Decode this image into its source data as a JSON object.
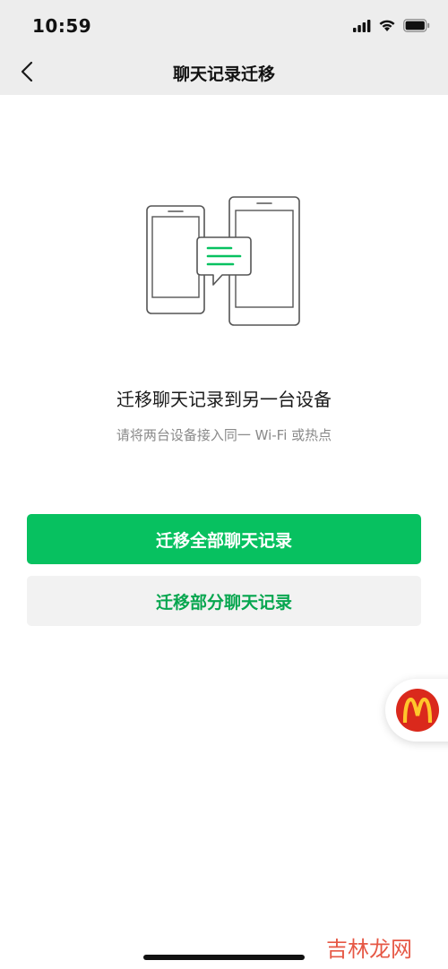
{
  "status_bar": {
    "time": "10:59",
    "icons": [
      "signal-icon",
      "wifi-icon",
      "battery-icon"
    ]
  },
  "nav": {
    "title": "聊天记录迁移",
    "back_icon": "chevron-left-icon"
  },
  "main": {
    "illustration_icon": "phones-transfer-icon",
    "heading": "迁移聊天记录到另一台设备",
    "subtitle": "请将两台设备接入同一 Wi-Fi 或热点"
  },
  "buttons": {
    "migrate_all": "迁移全部聊天记录",
    "migrate_partial": "迁移部分聊天记录"
  },
  "floating_widget": {
    "icon": "mcdonalds-logo-icon"
  },
  "watermark": {
    "text": "吉林龙网"
  },
  "colors": {
    "brand_green": "#07c160",
    "nav_bg": "#ededed",
    "subtitle_gray": "#8a8a8a",
    "mcd_red": "#da291c",
    "mcd_yellow": "#ffc72c"
  }
}
